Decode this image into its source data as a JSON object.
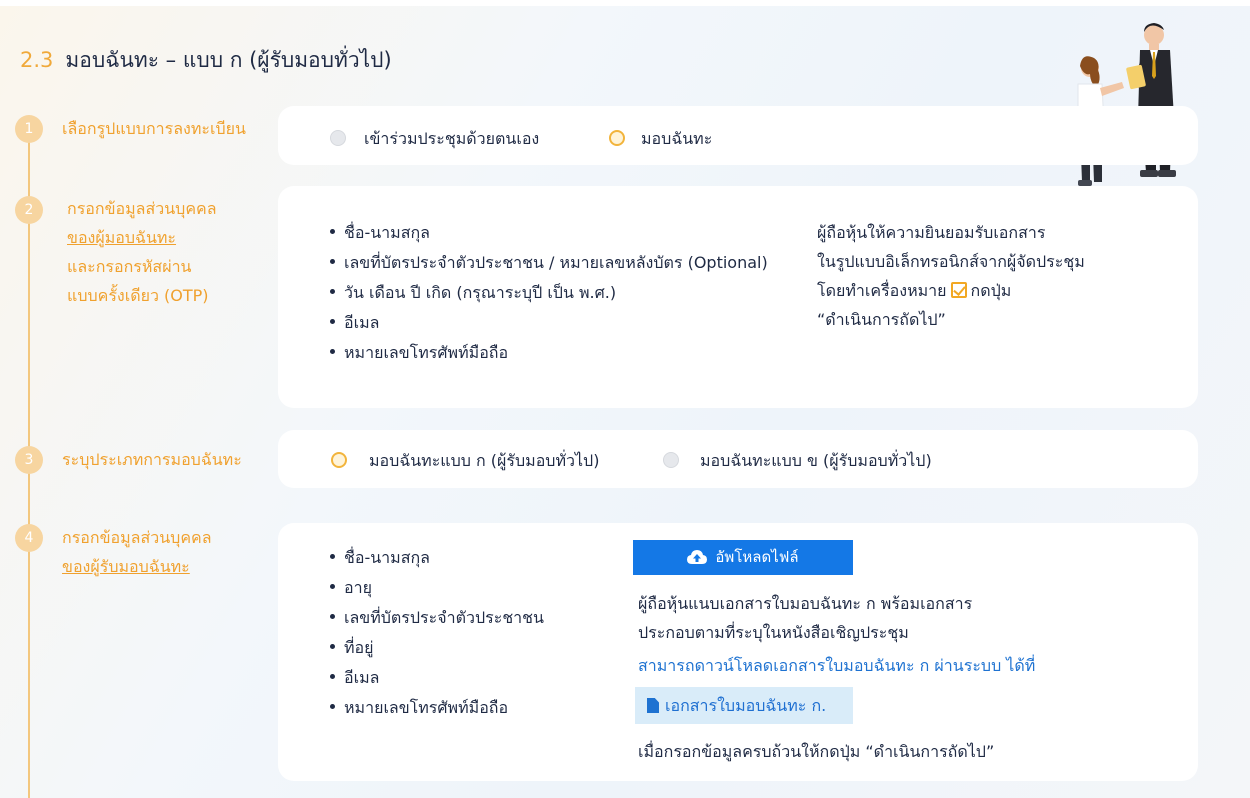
{
  "title": {
    "number": "2.3",
    "text": "มอบฉันทะ – แบบ ก (ผู้รับมอบทั่วไป)"
  },
  "steps": [
    {
      "num": "1",
      "label_lines": [
        "เลือกรูปแบบการลงทะเบียน"
      ]
    },
    {
      "num": "2",
      "label_lines": [
        "กรอกข้อมูลส่วนบุคคล",
        "ของผู้มอบฉันทะ",
        "และกรอกรหัสผ่าน",
        "แบบครั้งเดียว (OTP)"
      ]
    },
    {
      "num": "3",
      "label_lines": [
        "ระบุประเภทการมอบฉันทะ"
      ]
    },
    {
      "num": "4",
      "label_lines": [
        "กรอกข้อมูลส่วนบุคคล",
        "ของผู้รับมอบฉันทะ"
      ]
    }
  ],
  "step1": {
    "options": [
      {
        "label": "เข้าร่วมประชุมด้วยตนเอง",
        "selected": false
      },
      {
        "label": "มอบฉันทะ",
        "selected": true
      }
    ]
  },
  "step2": {
    "fields": [
      "ชื่อ-นามสกุล",
      "เลขที่บัตรประจำตัวประชาชน / หมายเลขหลังบัตร (Optional)",
      "วัน เดือน ปี เกิด (กรุณาระบุปี เป็น พ.ศ.)",
      "อีเมล",
      "หมายเลขโทรศัพท์มือถือ"
    ],
    "note": {
      "line1": "ผู้ถือหุ้นให้ความยินยอมรับเอกสาร",
      "line2": "ในรูปแบบอิเล็กทรอนิกส์จากผู้จัดประชุม",
      "line3_before": "โดยทำเครื่องหมาย",
      "line3_after": "กดปุ่ม",
      "line4": "“ดำเนินการถัดไป”"
    }
  },
  "step3": {
    "options": [
      {
        "label": "มอบฉันทะแบบ ก (ผู้รับมอบทั่วไป)",
        "selected": true
      },
      {
        "label": "มอบฉันทะแบบ ข (ผู้รับมอบทั่วไป)",
        "selected": false
      }
    ]
  },
  "step4": {
    "fields": [
      "ชื่อ-นามสกุล",
      "อายุ",
      "เลขที่บัตรประจำตัวประชาชน",
      "ที่อยู่",
      "อีเมล",
      "หมายเลขโทรศัพท์มือถือ"
    ],
    "upload_label": "อัพโหลดไฟล์",
    "note_line1": "ผู้ถือหุ้นแนบเอกสารใบมอบฉันทะ ก พร้อมเอกสาร",
    "note_line2": "ประกอบตามที่ระบุในหนังสือเชิญประชุม",
    "download_text": "สามารถดาวน์โหลดเอกสารใบมอบฉันทะ ก ผ่านระบบ ได้ที่",
    "doc_label": "เอกสารใบมอบฉันทะ ก.",
    "final_note": "เมื่อกรอกข้อมูลครบถ้วนให้กดปุ่ม “ดำเนินการถัดไป”"
  },
  "colors": {
    "accent": "#f0a12e",
    "primary_blue": "#1478e6",
    "text": "#1f2a44"
  }
}
